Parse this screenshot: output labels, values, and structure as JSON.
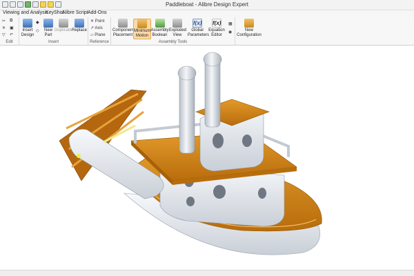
{
  "window": {
    "title": "Paddleboat - Alibre Design Expert"
  },
  "menu": [
    "Viewing and Analysis",
    "KeyShot",
    "Alibre Script",
    "Add-Ons"
  ],
  "ribbon": {
    "groups": [
      {
        "label": "Edit"
      },
      {
        "label": "Insert"
      },
      {
        "label": "Reference"
      },
      {
        "label": "Assembly Tools"
      }
    ],
    "insert": {
      "insert_design": [
        "Insert",
        "Design"
      ],
      "new_part": [
        "New",
        "Part"
      ],
      "duplicate": "Duplicate",
      "replace": "Replace"
    },
    "reference": {
      "point": "Point",
      "axis": "Axis",
      "plane": "Plane"
    },
    "tools": {
      "component_placement": [
        "Component",
        "Placement"
      ],
      "minimum_motion": [
        "Minimum",
        "Motion"
      ],
      "assembly_boolean": [
        "Assembly",
        "Boolean"
      ],
      "exploded_view": [
        "Exploded",
        "View"
      ],
      "global_parameters": [
        "Global",
        "Parameters"
      ],
      "equation_editor": [
        "Equation",
        "Editor"
      ],
      "new_configuration": [
        "New",
        "Configuration"
      ]
    },
    "icons": {
      "global_parameters": "f(x)",
      "equation_editor": "f(x)"
    }
  },
  "colors": {
    "hull_orange": "#d98a1a",
    "hull_white": "#e9edf2",
    "paddle_brown": "#b5670f",
    "active_tool": "#fbd9a8"
  }
}
